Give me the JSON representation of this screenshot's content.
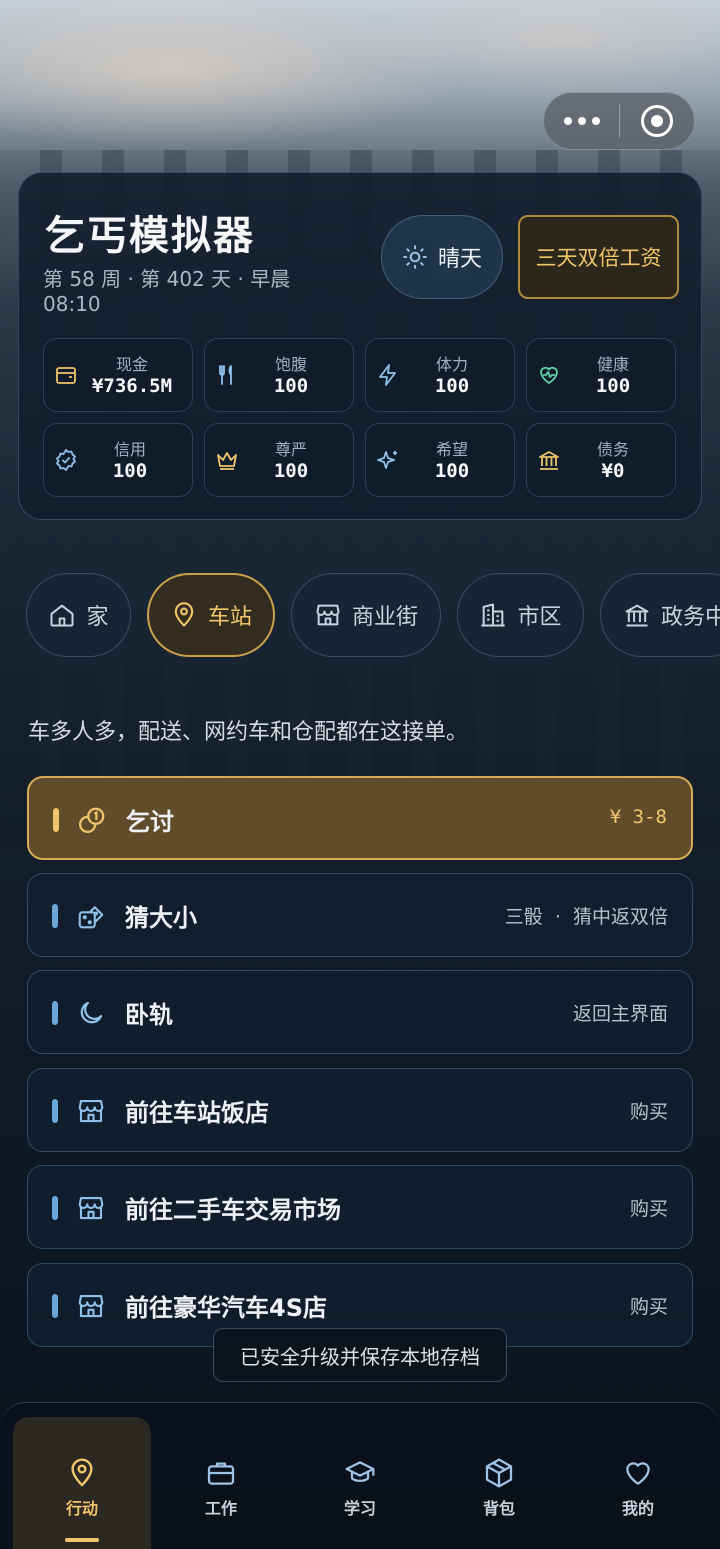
{
  "game": {
    "title": "乞丐模拟器",
    "subline": "第 58 周 · 第 402 天 · 早晨 08:10",
    "weather": "晴天",
    "bonus": "三天双倍工资"
  },
  "stats": [
    {
      "label": "现金",
      "value": "¥736.5M",
      "icon": "wallet-icon"
    },
    {
      "label": "饱腹",
      "value": "100",
      "icon": "utensils-icon"
    },
    {
      "label": "体力",
      "value": "100",
      "icon": "lightning-icon"
    },
    {
      "label": "健康",
      "value": "100",
      "icon": "heart-pulse-icon"
    },
    {
      "label": "信用",
      "value": "100",
      "icon": "badge-check-icon"
    },
    {
      "label": "尊严",
      "value": "100",
      "icon": "crown-icon"
    },
    {
      "label": "希望",
      "value": "100",
      "icon": "sparkles-icon"
    },
    {
      "label": "债务",
      "value": "¥0",
      "icon": "bank-icon"
    }
  ],
  "locations": [
    {
      "label": "家",
      "icon": "home-icon"
    },
    {
      "label": "车站",
      "icon": "map-pin-icon",
      "active": true
    },
    {
      "label": "商业街",
      "icon": "store-icon"
    },
    {
      "label": "市区",
      "icon": "buildings-icon"
    },
    {
      "label": "政务中",
      "icon": "bank-icon"
    }
  ],
  "location_description": "车多人多，配送、网约车和仓配都在这接单。",
  "actions": [
    {
      "name": "乞讨",
      "meta": "¥ 3-8",
      "icon": "coins-icon",
      "primary": true
    },
    {
      "name": "猜大小",
      "meta": "三骰  ·  猜中返双倍",
      "icon": "dice-icon"
    },
    {
      "name": "卧轨",
      "meta": "返回主界面",
      "icon": "moon-icon"
    },
    {
      "name": "前往车站饭店",
      "meta": "购买",
      "icon": "store-icon"
    },
    {
      "name": "前往二手车交易市场",
      "meta": "购买",
      "icon": "store-icon"
    },
    {
      "name": "前往豪华汽车4S店",
      "meta": "购买",
      "icon": "store-icon"
    }
  ],
  "toast": "已安全升级并保存本地存档",
  "nav": [
    {
      "label": "行动",
      "icon": "map-pin-icon",
      "active": true
    },
    {
      "label": "工作",
      "icon": "briefcase-icon"
    },
    {
      "label": "学习",
      "icon": "graduation-cap-icon"
    },
    {
      "label": "背包",
      "icon": "package-icon"
    },
    {
      "label": "我的",
      "icon": "heart-icon"
    }
  ],
  "colors": {
    "accent": "#f0c46a",
    "card_bg": "#121e2c",
    "info_bar": "#6aa7d8"
  }
}
